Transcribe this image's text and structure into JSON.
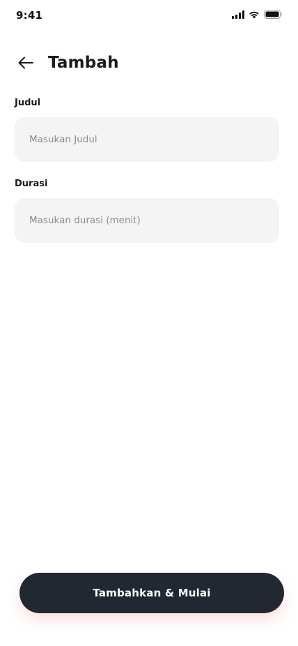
{
  "status_bar": {
    "time": "9:41"
  },
  "header": {
    "back_icon": "arrow-left-icon",
    "title": "Tambah"
  },
  "form": {
    "title_field": {
      "label": "Judul",
      "value": "",
      "placeholder": "Masukan Judul"
    },
    "duration_field": {
      "label": "Durasi",
      "value": "",
      "placeholder": "Masukan durasi (menit)"
    }
  },
  "actions": {
    "submit_label": "Tambahkan & Mulai"
  },
  "colors": {
    "button_background": "#222831",
    "input_background": "#f4f4f4",
    "placeholder_text": "#8c8c8c"
  }
}
